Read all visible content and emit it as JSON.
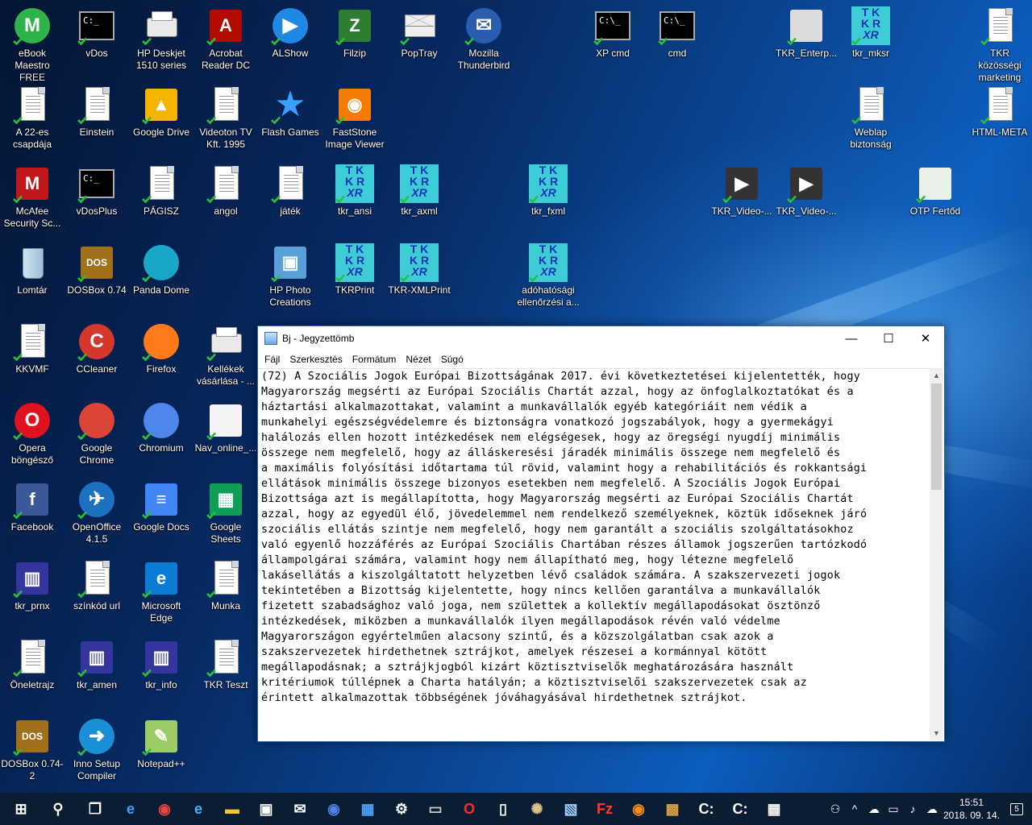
{
  "desktop_icons": [
    {
      "name": "ebook-maestro-icon",
      "label": "eBook Maestro FREE",
      "kind": "circle",
      "color": "#2db34a",
      "glyph": "M"
    },
    {
      "name": "vdos-icon",
      "label": "vDos",
      "kind": "cmd",
      "glyph": "C:_"
    },
    {
      "name": "hp-deskjet-icon",
      "label": "HP Deskjet 1510 series",
      "kind": "printer"
    },
    {
      "name": "acrobat-reader-icon",
      "label": "Acrobat Reader DC",
      "kind": "sq",
      "color": "#b30b00",
      "glyph": "A"
    },
    {
      "name": "alshow-icon",
      "label": "ALShow",
      "kind": "circle",
      "color": "#1e88e5",
      "glyph": "▶"
    },
    {
      "name": "filzip-icon",
      "label": "Filzip",
      "kind": "sq",
      "color": "#2e7d32",
      "glyph": "Z"
    },
    {
      "name": "poptray-icon",
      "label": "PopTray",
      "kind": "mail"
    },
    {
      "name": "thunderbird-icon",
      "label": "Mozilla Thunderbird",
      "kind": "circle",
      "color": "#2a5db0",
      "glyph": "✉"
    },
    {
      "name": "xp-cmd-icon",
      "label": "XP cmd",
      "kind": "cmd",
      "glyph": "C:\\_"
    },
    {
      "name": "cmd-icon",
      "label": "cmd",
      "kind": "cmd",
      "glyph": "C:\\_"
    },
    {
      "name": "tkr-enterp-icon",
      "label": "TKR_Enterp...",
      "kind": "sq",
      "color": "#dcdcdc",
      "glyph": ""
    },
    {
      "name": "tkr-mksr-icon",
      "label": "tkr_mksr",
      "kind": "tkr"
    },
    {
      "name": "tkr-kozossegi-icon",
      "label": "TKR közösségi marketing",
      "kind": "doc"
    },
    {
      "name": "a22-icon",
      "label": "A 22-es csapdája",
      "kind": "doc"
    },
    {
      "name": "einstein-icon",
      "label": "Einstein",
      "kind": "doc"
    },
    {
      "name": "google-drive-icon",
      "label": "Google Drive",
      "kind": "sq",
      "color": "#f4b400",
      "glyph": "▲"
    },
    {
      "name": "videoton-icon",
      "label": "Videoton TV Kft. 1995",
      "kind": "doc"
    },
    {
      "name": "flash-games-icon",
      "label": "Flash Games",
      "kind": "star"
    },
    {
      "name": "faststone-icon",
      "label": "FastStone Image Viewer",
      "kind": "sq",
      "color": "#f57c00",
      "glyph": "◉"
    },
    {
      "name": "weblap-icon",
      "label": "Weblap biztonság",
      "kind": "doc"
    },
    {
      "name": "html-meta-icon",
      "label": "HTML-META",
      "kind": "doc"
    },
    {
      "name": "mcafee-icon",
      "label": "McAfee Security Sc...",
      "kind": "sq",
      "color": "#c01818",
      "glyph": "M"
    },
    {
      "name": "vdosplus-icon",
      "label": "vDosPlus",
      "kind": "cmd",
      "glyph": "C:_"
    },
    {
      "name": "pagisz-icon",
      "label": "PÁGISZ",
      "kind": "doc"
    },
    {
      "name": "angol-icon",
      "label": "angol",
      "kind": "doc"
    },
    {
      "name": "jatek-icon",
      "label": "játék",
      "kind": "doc"
    },
    {
      "name": "tkr-ansi-icon",
      "label": "tkr_ansi",
      "kind": "tkr"
    },
    {
      "name": "tkr-axml-icon",
      "label": "tkr_axml",
      "kind": "tkr"
    },
    {
      "name": "tkr-fxml-icon",
      "label": "tkr_fxml",
      "kind": "tkr"
    },
    {
      "name": "tkr-video1-icon",
      "label": "TKR_Video-...",
      "kind": "sq",
      "color": "#333",
      "glyph": "▶"
    },
    {
      "name": "tkr-video2-icon",
      "label": "TKR_Video-...",
      "kind": "sq",
      "color": "#333",
      "glyph": "▶"
    },
    {
      "name": "otp-fertod-icon",
      "label": "OTP Fertőd",
      "kind": "sq",
      "color": "#e8f0e8",
      "glyph": ""
    },
    {
      "name": "lomtar-icon",
      "label": "Lomtár",
      "kind": "bin"
    },
    {
      "name": "dosbox-icon",
      "label": "DOSBox 0.74",
      "kind": "sq",
      "color": "#a0701a",
      "glyph": "DOS"
    },
    {
      "name": "panda-dome-icon",
      "label": "Panda Dome",
      "kind": "circle",
      "color": "#19a7c9",
      "glyph": ""
    },
    {
      "name": "hp-photo-icon",
      "label": "HP Photo Creations",
      "kind": "sq",
      "color": "#5aa0d8",
      "glyph": "▣"
    },
    {
      "name": "tkrprint-icon",
      "label": "TKRPrint",
      "kind": "tkr"
    },
    {
      "name": "tkr-xmlprint-icon",
      "label": "TKR-XMLPrint",
      "kind": "tkr"
    },
    {
      "name": "adohatosagi-icon",
      "label": "adóhatósági ellenőrzési a...",
      "kind": "tkr"
    },
    {
      "name": "kkvmf-icon",
      "label": "KKVMF",
      "kind": "doc"
    },
    {
      "name": "ccleaner-icon",
      "label": "CCleaner",
      "kind": "circle",
      "color": "#d4382c",
      "glyph": "C"
    },
    {
      "name": "firefox-icon",
      "label": "Firefox",
      "kind": "circle",
      "color": "#ff7a1a",
      "glyph": ""
    },
    {
      "name": "kellekek-icon",
      "label": "Kellékek vásárlása - ...",
      "kind": "printer"
    },
    {
      "name": "opera-icon",
      "label": "Opera böngésző",
      "kind": "circle",
      "color": "#e0121f",
      "glyph": "O"
    },
    {
      "name": "google-chrome-icon",
      "label": "Google Chrome",
      "kind": "circle",
      "color": "#db4437",
      "glyph": ""
    },
    {
      "name": "chromium-icon",
      "label": "Chromium",
      "kind": "circle",
      "color": "#4f86ec",
      "glyph": ""
    },
    {
      "name": "nav-online-icon",
      "label": "Nav_online_...",
      "kind": "sq",
      "color": "#f4f4f4",
      "glyph": ""
    },
    {
      "name": "facebook-icon",
      "label": "Facebook",
      "kind": "sq",
      "color": "#3b5998",
      "glyph": "f"
    },
    {
      "name": "openoffice-icon",
      "label": "OpenOffice 4.1.5",
      "kind": "circle",
      "color": "#1e70c1",
      "glyph": "✈"
    },
    {
      "name": "google-docs-icon",
      "label": "Google Docs",
      "kind": "sq",
      "color": "#4285f4",
      "glyph": "≡"
    },
    {
      "name": "google-sheets-icon",
      "label": "Google Sheets",
      "kind": "sq",
      "color": "#0f9d58",
      "glyph": "▦"
    },
    {
      "name": "tkr-prnx-icon",
      "label": "tkr_prnx",
      "kind": "sq",
      "color": "#3535a0",
      "glyph": "▥"
    },
    {
      "name": "szinkod-url-icon",
      "label": "színkód url",
      "kind": "doc"
    },
    {
      "name": "microsoft-edge-icon",
      "label": "Microsoft Edge",
      "kind": "sq",
      "color": "#0a7cd6",
      "glyph": "e"
    },
    {
      "name": "munka-icon",
      "label": "Munka",
      "kind": "doc"
    },
    {
      "name": "oneletrajz-icon",
      "label": "Öneletrajz",
      "kind": "doc"
    },
    {
      "name": "tkr-amen-icon",
      "label": "tkr_amen",
      "kind": "sq",
      "color": "#3535a0",
      "glyph": "▥"
    },
    {
      "name": "tkr-info-icon",
      "label": "tkr_info",
      "kind": "sq",
      "color": "#3535a0",
      "glyph": "▥"
    },
    {
      "name": "tkr-teszt-icon",
      "label": "TKR Teszt",
      "kind": "doc"
    },
    {
      "name": "dosbox2-icon",
      "label": "DOSBox 0.74-2",
      "kind": "sq",
      "color": "#a0701a",
      "glyph": "DOS"
    },
    {
      "name": "inno-setup-icon",
      "label": "Inno Setup Compiler",
      "kind": "circle",
      "color": "#1a8fd6",
      "glyph": "➜"
    },
    {
      "name": "notepadpp-icon",
      "label": "Notepad++",
      "kind": "sq",
      "color": "#9ccc65",
      "glyph": "✎"
    }
  ],
  "notepad": {
    "title": "Bj - Jegyzettömb",
    "menu": [
      "Fájl",
      "Szerkesztés",
      "Formátum",
      "Nézet",
      "Súgó"
    ],
    "minimize": "—",
    "maximize": "☐",
    "close": "✕",
    "lines": [
      "(72) A Szociális Jogok Európai Bizottságának 2017. évi következtetései kijelentették, hogy",
      "Magyarország megsérti az Európai Szociális Chartát azzal, hogy az önfoglalkoztatókat és a",
      "háztartási alkalmazottakat, valamint a munkavállalók egyéb kategóriáit nem védik a",
      "munkahelyi egészségvédelemre és biztonságra vonatkozó jogszabályok, hogy a gyermekágyi",
      "halálozás ellen hozott intézkedések nem elégségesek, hogy az öregségi nyugdíj minimális",
      "összege nem megfelelő, hogy az álláskeresési járadék minimális összege nem megfelelő és",
      "a maximális folyósítási időtartama túl rövid, valamint hogy a rehabilitációs és rokkantsági",
      "ellátások minimális összege bizonyos esetekben nem megfelelő. A Szociális Jogok Európai",
      "Bizottsága azt is megállapította, hogy Magyarország megsérti az Európai Szociális Chartát",
      "azzal, hogy az egyedül élő, jövedelemmel nem rendelkező személyeknek, köztük időseknek járó",
      "szociális ellátás szintje nem megfelelő, hogy nem garantált a szociális szolgáltatásokhoz",
      "való egyenlő hozzáférés az Európai Szociális Chartában részes államok jogszerűen tartózkodó",
      "állampolgárai számára, valamint hogy nem állapítható meg, hogy létezne megfelelő",
      "lakásellátás a kiszolgáltatott helyzetben lévő családok számára. A szakszervezeti jogok",
      "tekintetében a Bizottság kijelentette, hogy nincs kellően garantálva a munkavállalók",
      "fizetett szabadsághoz való joga, nem születtek a kollektív megállapodásokat ösztönző",
      "intézkedések, miközben a munkavállalók ilyen megállapodások révén való védelme",
      "Magyarországon egyértelműen alacsony szintű, és a közszolgálatban csak azok a",
      "szakszervezetek hirdethetnek sztrájkot, amelyek részesei a kormánnyal kötött",
      "megállapodásnak; a sztrájkjogból kizárt köztisztviselők meghatározására használt",
      "kritériumok túllépnek a Charta hatályán; a köztisztviselői szakszervezetek csak az",
      "érintett alkalmazottak többségének jóváhagyásával hirdethetnek sztrájkot."
    ]
  },
  "taskbar": {
    "items": [
      {
        "name": "start-button",
        "glyph": "⊞",
        "color": "#ffffff"
      },
      {
        "name": "search-icon",
        "glyph": "⚲",
        "color": "#ffffff"
      },
      {
        "name": "task-view-icon",
        "glyph": "❐",
        "color": "#ffffff"
      },
      {
        "name": "edge-taskbar-icon",
        "glyph": "e",
        "color": "#3ea0ff"
      },
      {
        "name": "chrome-taskbar-icon",
        "glyph": "◉",
        "color": "#e8453c"
      },
      {
        "name": "ie-taskbar-icon",
        "glyph": "e",
        "color": "#45b0ff"
      },
      {
        "name": "explorer-taskbar-icon",
        "glyph": "▬",
        "color": "#f3c331"
      },
      {
        "name": "store-taskbar-icon",
        "glyph": "▣",
        "color": "#ffffff"
      },
      {
        "name": "mail-taskbar-icon",
        "glyph": "✉",
        "color": "#ffffff"
      },
      {
        "name": "thunderbird-taskbar-icon",
        "glyph": "◉",
        "color": "#4f86ec"
      },
      {
        "name": "app-taskbar-icon",
        "glyph": "▦",
        "color": "#4fa3ff"
      },
      {
        "name": "settings-taskbar-icon",
        "glyph": "⚙",
        "color": "#ffffff"
      },
      {
        "name": "cmd-taskbar-icon",
        "glyph": "▭",
        "color": "#cccccc"
      },
      {
        "name": "opera-taskbar-icon",
        "glyph": "O",
        "color": "#ff2a2a"
      },
      {
        "name": "document-taskbar-icon",
        "glyph": "▯",
        "color": "#ffffff"
      },
      {
        "name": "paint-taskbar-icon",
        "glyph": "✺",
        "color": "#e0c08a"
      },
      {
        "name": "notepad-taskbar-icon",
        "glyph": "▧",
        "color": "#9fd0ff"
      },
      {
        "name": "filezilla-taskbar-icon",
        "glyph": "Fz",
        "color": "#ff3b30"
      },
      {
        "name": "firefox-taskbar-icon",
        "glyph": "◉",
        "color": "#ff8c1a"
      },
      {
        "name": "dosbox-taskbar-icon",
        "glyph": "▩",
        "color": "#d8a040"
      },
      {
        "name": "vdos-taskbar-icon",
        "glyph": "C:",
        "color": "#ffffff"
      },
      {
        "name": "vdosplus-taskbar-icon",
        "glyph": "C:",
        "color": "#ffffff"
      },
      {
        "name": "calculator-taskbar-icon",
        "glyph": "▦",
        "color": "#ffffff"
      }
    ],
    "tray": [
      "⚇",
      "^",
      "☁",
      "▭",
      "♪",
      "☁"
    ],
    "time": "15:51",
    "date": "2018. 09. 14.",
    "notifications": "5"
  }
}
